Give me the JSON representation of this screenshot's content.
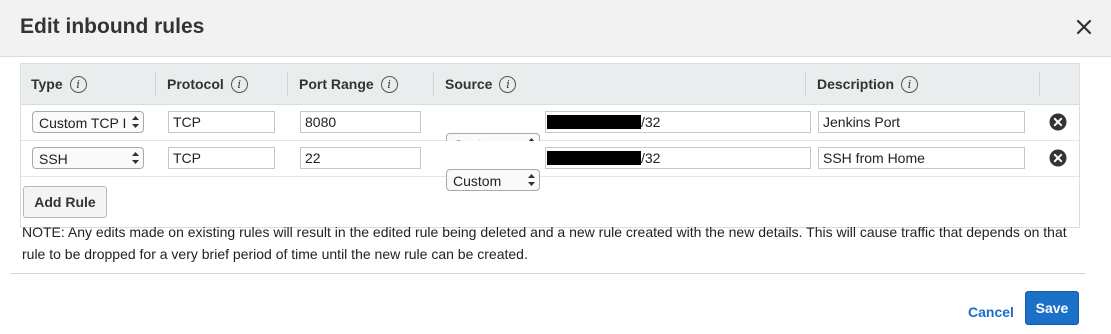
{
  "dialog": {
    "title": "Edit inbound rules"
  },
  "table": {
    "headers": {
      "type": "Type",
      "protocol": "Protocol",
      "port_range": "Port Range",
      "source": "Source",
      "description": "Description"
    },
    "info_glyph": "i",
    "rows": [
      {
        "type": "Custom TCP I",
        "protocol": "TCP",
        "port_range": "8080",
        "source_type": "Custom",
        "source_suffix": "/32",
        "description": "Jenkins Port"
      },
      {
        "type": "SSH",
        "protocol": "TCP",
        "port_range": "22",
        "source_type": "Custom",
        "source_suffix": "/32",
        "description": "SSH from Home"
      }
    ]
  },
  "add_rule_label": "Add Rule",
  "note": "NOTE: Any edits made on existing rules will result in the edited rule being deleted and a new rule created with the new details. This will cause traffic that depends on that rule to be dropped for a very brief period of time until the new rule can be created.",
  "footer": {
    "cancel_label": "Cancel",
    "save_label": "Save"
  },
  "icons": {
    "close": "close-icon",
    "info": "info-icon",
    "remove": "remove-rule-icon",
    "select_arrows": "select-arrows-icon"
  },
  "colors": {
    "header_bg": "#f2f2f2",
    "table_head_bg": "#eaeded",
    "primary_button": "#1b70c8",
    "link": "#1a6cc6"
  }
}
